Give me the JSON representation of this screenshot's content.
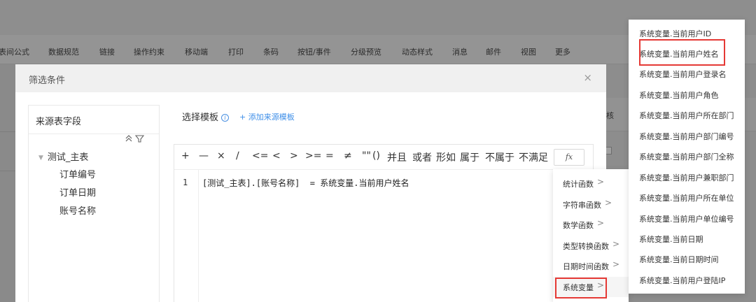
{
  "toolbar_items": [
    "表间公式",
    "数据规范",
    "链接",
    "操作约束",
    "移动端",
    "打印",
    "条码",
    "按钮/事件",
    "分级预览",
    "动态样式",
    "消息",
    "邮件",
    "视图",
    "更多"
  ],
  "background_column_label": "核",
  "dialog": {
    "title": "筛选条件",
    "close_label": "×",
    "source_panel": {
      "title": "来源表字段",
      "icons": "≈ ∀",
      "tree_root": "测试_主表",
      "fields": [
        "订单编号",
        "订单日期",
        "账号名称"
      ]
    },
    "template": {
      "label": "选择模板",
      "info_icon": "i",
      "add_link": "+ 添加来源模板"
    },
    "editor": {
      "operators": [
        "+",
        "—",
        "×",
        "∕",
        "<=",
        "<",
        ">",
        ">=",
        "=",
        "≠",
        "\"\"",
        "()",
        "并且",
        "或者",
        "形如",
        "属于",
        "不属于",
        "不满足"
      ],
      "fx_label": "fx",
      "line_number": "1",
      "code": "[测试_主表].[账号名称]  = 系统变量.当前用户姓名"
    }
  },
  "function_menu": {
    "items": [
      "统计函数",
      "字符串函数",
      "数学函数",
      "类型转换函数",
      "日期时间函数",
      "系统变量"
    ],
    "arrow": ">",
    "active_index": 5
  },
  "system_variables": {
    "items": [
      "系统变量.当前用户ID",
      "系统变量.当前用户姓名",
      "系统变量.当前用户登录名",
      "系统变量.当前用户角色",
      "系统变量.当前用户所在部门",
      "系统变量.当前用户部门编号",
      "系统变量.当前用户部门全称",
      "系统变量.当前用户兼职部门",
      "系统变量.当前用户所在单位",
      "系统变量.当前用户单位编号",
      "系统变量.当前日期",
      "系统变量.当前日期时间",
      "系统变量.当前用户登陆IP"
    ],
    "highlighted_index": 1
  },
  "colors": {
    "highlight": "#e53935",
    "link": "#3d8ee8",
    "overlay": "#8c8c8c"
  }
}
